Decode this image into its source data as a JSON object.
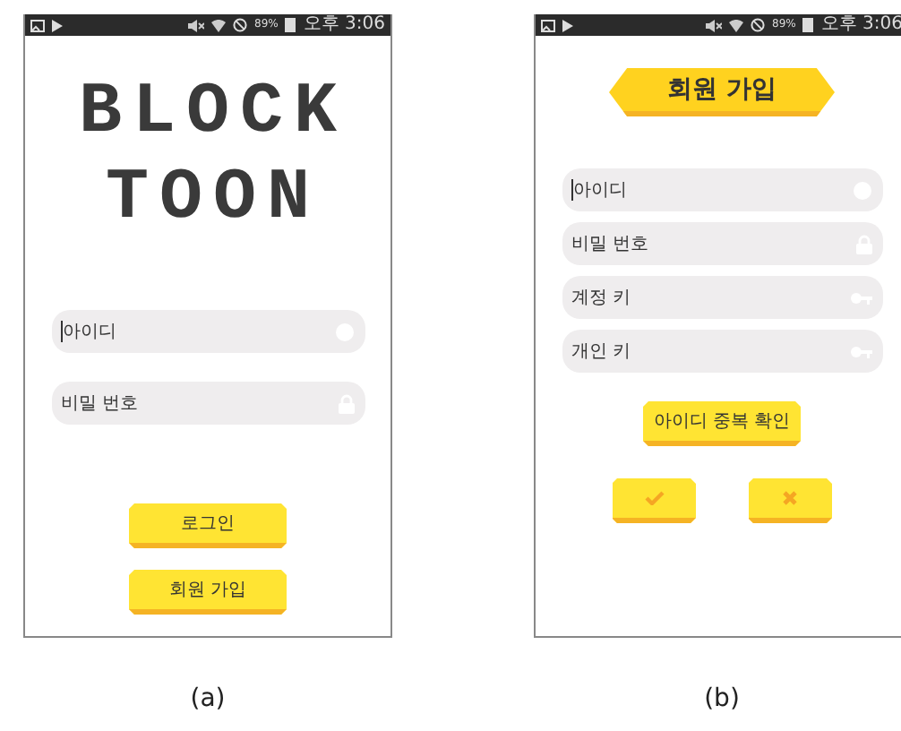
{
  "panels": [
    {
      "caption": "(a)",
      "status_bar": {
        "battery": "89%",
        "time": "오후 3:06"
      },
      "header": {
        "kind": "logo",
        "lines": [
          "BLOCK",
          "TOON"
        ]
      },
      "fields": [
        {
          "kind": "id",
          "placeholder": "아이디",
          "focused": true
        },
        {
          "kind": "password",
          "placeholder": "비밀 번호",
          "focused": false
        }
      ],
      "button_rows": [
        [
          {
            "kind": "text",
            "label": "로그인"
          }
        ],
        [
          {
            "kind": "text",
            "label": "회원 가입"
          }
        ]
      ]
    },
    {
      "caption": "(b)",
      "status_bar": {
        "battery": "89%",
        "time": "오후 3:06"
      },
      "header": {
        "kind": "banner",
        "text": "회원 가입"
      },
      "fields": [
        {
          "kind": "id",
          "placeholder": "아이디",
          "focused": true
        },
        {
          "kind": "password",
          "placeholder": "비밀 번호",
          "focused": false
        },
        {
          "kind": "key",
          "placeholder": "계정 키",
          "focused": false
        },
        {
          "kind": "key",
          "placeholder": "개인 키",
          "focused": false
        }
      ],
      "button_rows": [
        [
          {
            "kind": "text",
            "label": "아이디 중복 확인"
          }
        ],
        [
          {
            "kind": "confirm"
          },
          {
            "kind": "cancel"
          }
        ]
      ]
    }
  ]
}
